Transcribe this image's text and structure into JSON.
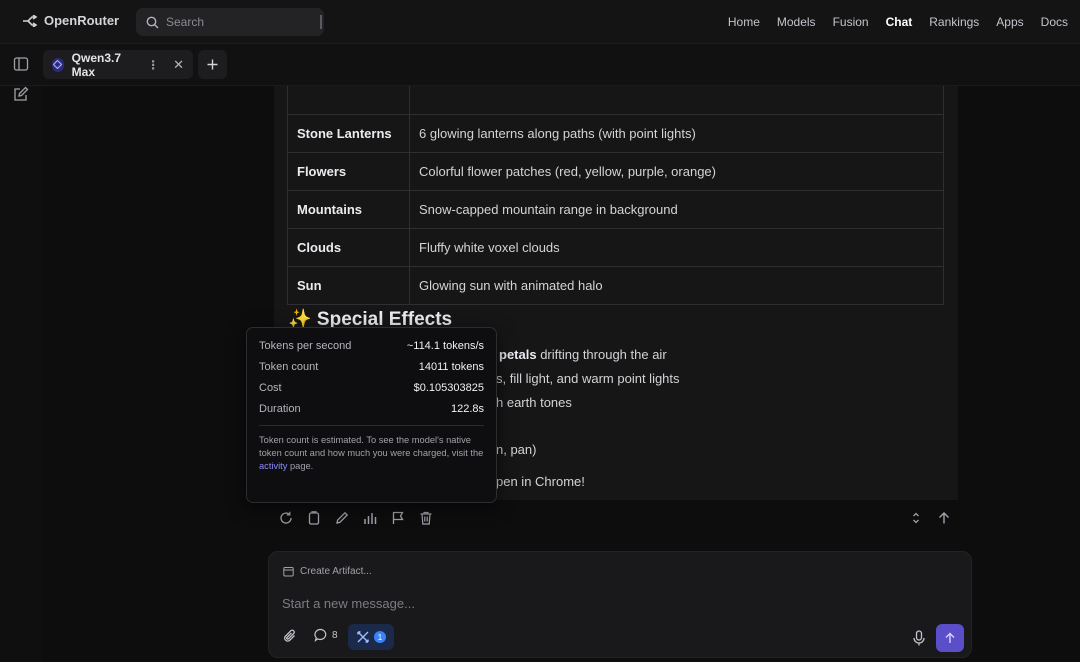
{
  "header": {
    "brand": "OpenRouter",
    "search_placeholder": "Search",
    "nav": [
      "Home",
      "Models",
      "Fusion",
      "Chat",
      "Rankings",
      "Apps",
      "Docs"
    ],
    "active_nav": "Chat"
  },
  "tabs": {
    "active_tab": "Qwen3.7 Max"
  },
  "message": {
    "table_rows": [
      {
        "key": "",
        "value": ""
      },
      {
        "key": "Stone Lanterns",
        "value": "6 glowing lanterns along paths (with point lights)"
      },
      {
        "key": "Flowers",
        "value": "Colorful flower patches (red, yellow, purple, orange)"
      },
      {
        "key": "Mountains",
        "value": "Snow-capped mountain range in background"
      },
      {
        "key": "Clouds",
        "value": "Fluffy white voxel clouds"
      },
      {
        "key": "Sun",
        "value": "Glowing sun with animated halo"
      }
    ],
    "heading": "✨ Special Effects",
    "bullets": {
      "b1_bold": "petals",
      "b1_rest": " drifting through the air",
      "b2": "s, fill light, and warm point lights",
      "b3": "h earth tones",
      "b4": "n, pan)",
      "b5": "pen in Chrome!"
    }
  },
  "tooltip": {
    "rows": [
      {
        "label": "Tokens per second",
        "value": "~114.1 tokens/s"
      },
      {
        "label": "Token count",
        "value": "14011 tokens"
      },
      {
        "label": "Cost",
        "value": "$0.105303825"
      },
      {
        "label": "Duration",
        "value": "122.8s"
      }
    ],
    "note_before": "Token count is estimated. To see the model's native token count and how much you were charged, visit the ",
    "note_link": "activity",
    "note_after": " page."
  },
  "composer": {
    "artifact_label": "Create Artifact...",
    "placeholder": "Start a new message...",
    "chat_count": "8",
    "tools_badge": "1"
  },
  "colors": {
    "accent": "#5b4fc9",
    "badge": "#3b82f6",
    "link": "#8b8bff"
  }
}
